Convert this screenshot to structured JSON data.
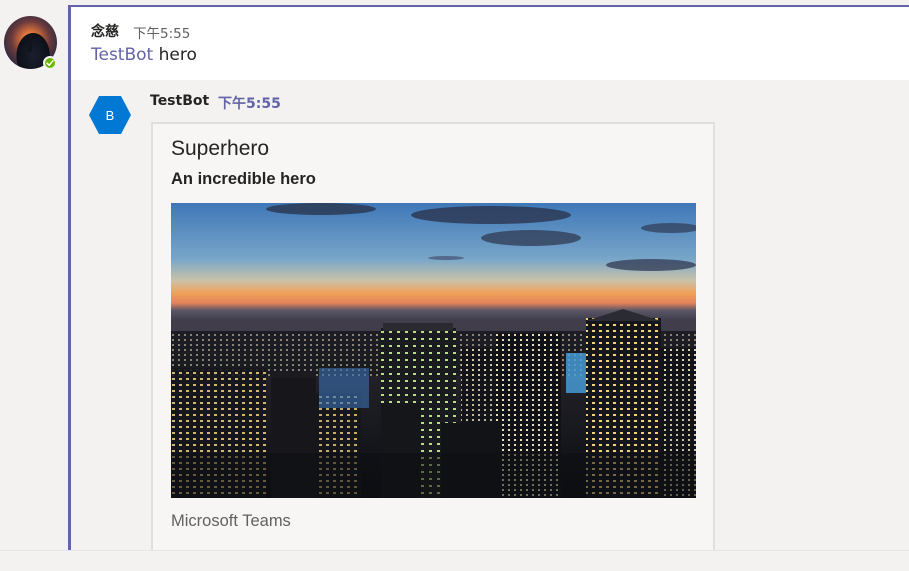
{
  "root_message": {
    "author": "念慈",
    "time": "下午5:55",
    "mention": "TestBot",
    "text": " hero"
  },
  "reply": {
    "avatar_initial": "B",
    "author": "TestBot",
    "time": "下午5:55",
    "card": {
      "title": "Superhero",
      "subtitle": "An incredible hero",
      "image": "city-skyline-at-dusk",
      "text": "Microsoft Teams"
    }
  },
  "colors": {
    "accent": "#6264a7",
    "presence_available": "#6bb700",
    "bot_avatar": "#0078d4",
    "background": "#f3f2f1"
  },
  "icons": {
    "presence": "check-icon"
  }
}
